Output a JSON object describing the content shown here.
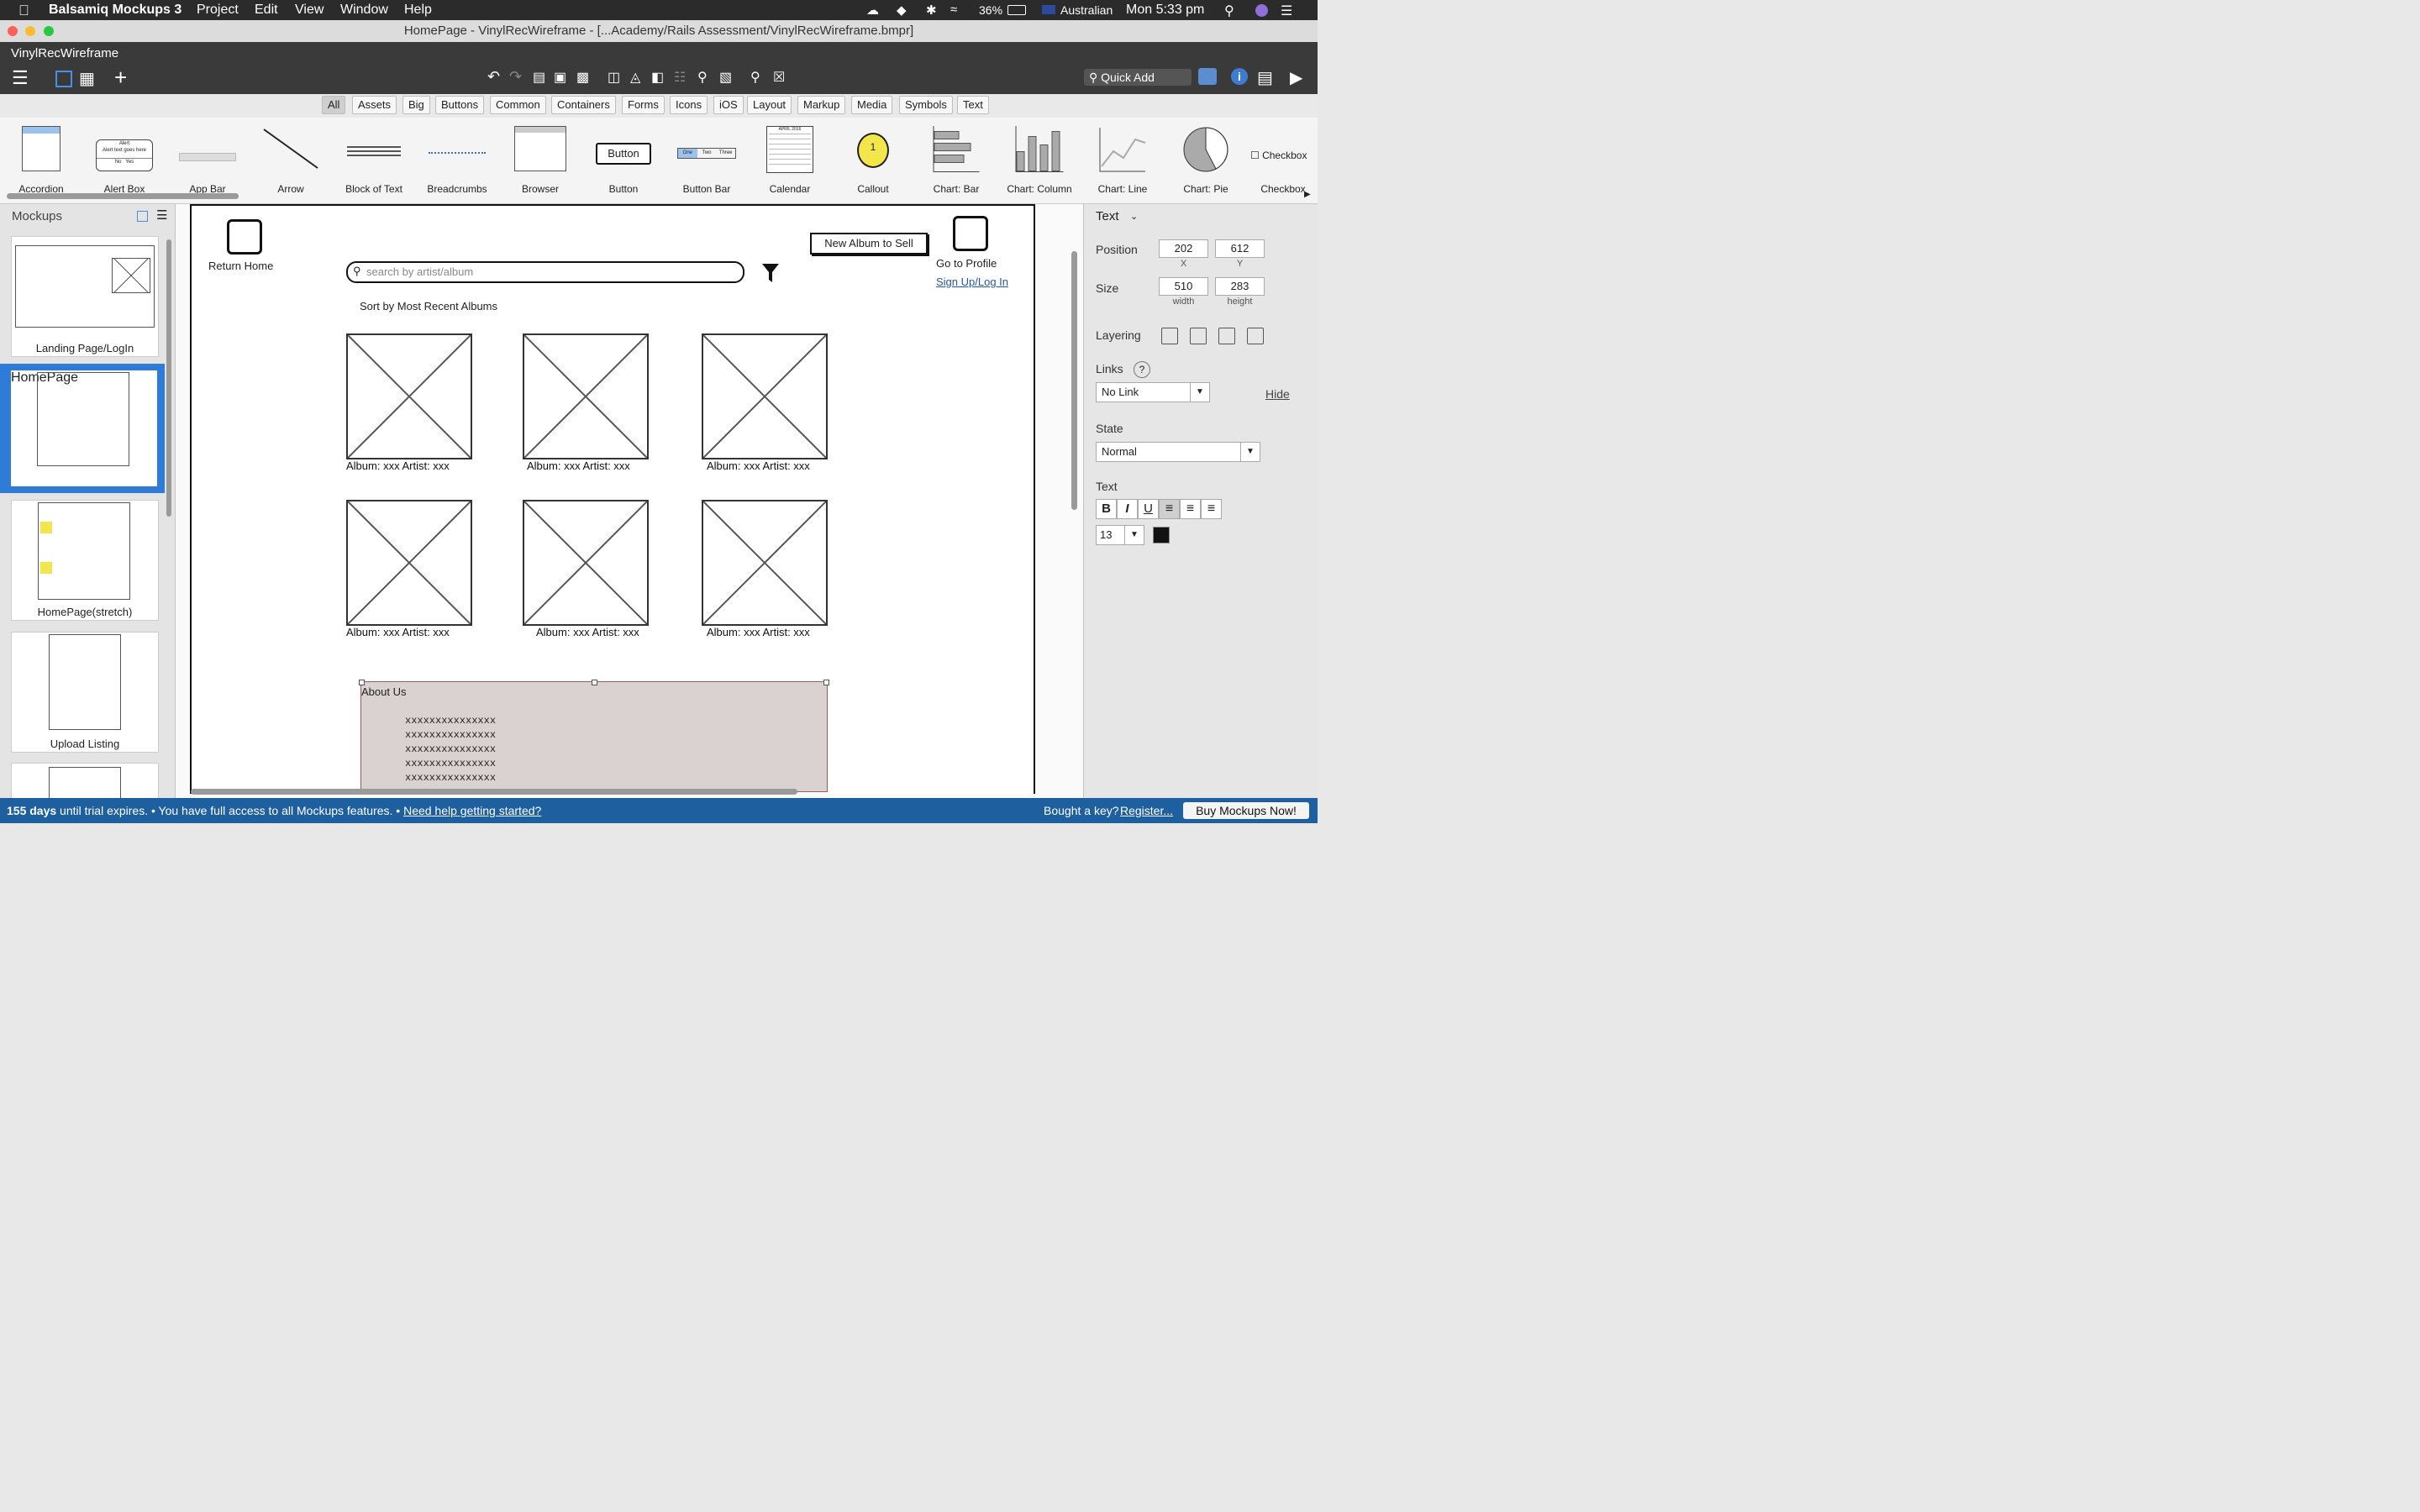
{
  "menubar": {
    "app": "Balsamiq Mockups 3",
    "items": [
      "Project",
      "Edit",
      "View",
      "Window",
      "Help"
    ],
    "battery": "36%",
    "input_source": "Australian",
    "clock": "Mon 5:33 pm"
  },
  "window": {
    "title": "HomePage - VinylRecWireframe - [...Academy/Rails Assessment/VinylRecWireframe.bmpr]"
  },
  "appbar": {
    "project_name": "VinylRecWireframe",
    "quick_add_placeholder": "Quick Add"
  },
  "filters": [
    "All",
    "Assets",
    "Big",
    "Buttons",
    "Common",
    "Containers",
    "Forms",
    "Icons",
    "iOS",
    "Layout",
    "Markup",
    "Media",
    "Symbols",
    "Text"
  ],
  "library": {
    "items": [
      "Accordion",
      "Alert Box",
      "App Bar",
      "Arrow",
      "Block of Text",
      "Breadcrumbs",
      "Browser",
      "Button",
      "Button Bar",
      "Calendar",
      "Callout",
      "Chart: Bar",
      "Chart: Column",
      "Chart: Line",
      "Chart: Pie",
      "Checkbox"
    ],
    "button_text": "Button",
    "callout_number": "1",
    "checkbox_text": "Checkbox",
    "calendar_month": "APRIL 2016",
    "alert_title": "Alert",
    "alert_text": "Alert text goes here",
    "alert_no": "No",
    "alert_yes": "Yes",
    "buttonbar": [
      "One",
      "Two",
      "Three"
    ]
  },
  "mockups_panel": {
    "title": "Mockups",
    "items": [
      "Landing Page/LogIn",
      "HomePage",
      "HomePage(stretch)",
      "Upload Listing"
    ]
  },
  "wireframe": {
    "return_home": "Return Home",
    "search_placeholder": "search by artist/album",
    "sell_button": "New Album to Sell",
    "go_profile": "Go to Profile",
    "signup": "Sign Up/Log In",
    "sort_label": "Sort by Most Recent Albums",
    "album_captions": [
      "Album: xxx Artist: xxx",
      "Album: xxx Artist: xxx",
      "Album: xxx Artist: xxx",
      "Album: xxx Artist: xxx",
      "Album: xxx Artist: xxx",
      "Album: xxx Artist: xxx"
    ],
    "about_title": "About Us",
    "about_lines": [
      "xxxxxxxxxxxxxxx",
      "xxxxxxxxxxxxxxx",
      "xxxxxxxxxxxxxxx",
      "xxxxxxxxxxxxxxx",
      "xxxxxxxxxxxxxxx"
    ]
  },
  "properties": {
    "type": "Text",
    "position_label": "Position",
    "pos_x": "202",
    "pos_y": "612",
    "x_label": "X",
    "y_label": "Y",
    "size_label": "Size",
    "width": "510",
    "height": "283",
    "width_label": "width",
    "height_label": "height",
    "layering_label": "Layering",
    "links_label": "Links",
    "links_help": "?",
    "link_value": "No Link",
    "hide_label": "Hide",
    "state_label": "State",
    "state_value": "Normal",
    "text_label": "Text",
    "bold": "B",
    "italic": "I",
    "underline": "U",
    "font_size": "13",
    "text_color": "#111111"
  },
  "statusbar": {
    "trial_days": "155 days",
    "trial_text": " until trial expires. • You have full access to all Mockups features. • ",
    "help_link": "Need help getting started?",
    "key_text": "Bought a key?",
    "register_link": "Register...",
    "buy_button": "Buy Mockups Now!"
  },
  "colors": {
    "menubar": "#2b2b2b",
    "statusbar": "#1d5f9f",
    "selection": "#2f7bd8",
    "about_bg": "#d9d2d0"
  }
}
